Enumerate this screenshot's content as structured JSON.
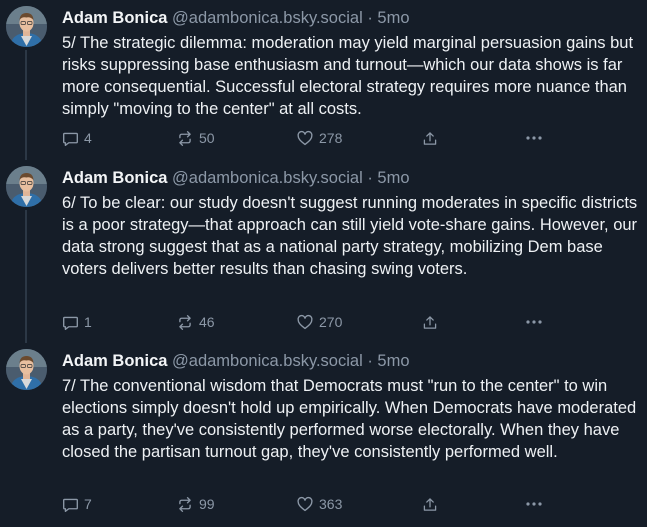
{
  "posts": [
    {
      "author": "Adam Bonica",
      "handle": "@adambonica.bsky.social",
      "separator": "·",
      "time": "5mo",
      "text": "5/ The strategic dilemma: moderation may yield marginal persuasion gains but risks suppressing base enthusiasm and turnout—which our data shows is far more consequential. Successful electoral strategy requires more nuance than simply \"moving to the center\" at all costs.",
      "replies": "4",
      "reposts": "50",
      "likes": "278"
    },
    {
      "author": "Adam Bonica",
      "handle": "@adambonica.bsky.social",
      "separator": "·",
      "time": "5mo",
      "text": "6/ To be clear: our study doesn't suggest running moderates in specific districts is a poor strategy—that approach can still yield vote-share gains. However, our data strong suggest that as a national party strategy, mobilizing Dem base voters delivers better results than chasing swing voters.",
      "replies": "1",
      "reposts": "46",
      "likes": "270"
    },
    {
      "author": "Adam Bonica",
      "handle": "@adambonica.bsky.social",
      "separator": "·",
      "time": "5mo",
      "text": "7/ The conventional wisdom that Democrats must \"run to the center\" to win elections simply doesn't hold up empirically. When Democrats have moderated as a party, they've consistently performed worse electorally. When they have closed the partisan turnout gap, they've consistently performed well.",
      "replies": "7",
      "reposts": "99",
      "likes": "363"
    }
  ],
  "colors": {
    "background": "#151d28",
    "text": "#eef1f4",
    "muted": "#8c98a7",
    "thread_line": "#2c3846"
  },
  "icons": {
    "reply": "speech-bubble-icon",
    "repost": "repost-arrows-icon",
    "like": "heart-icon",
    "share": "share-arrow-icon",
    "more": "ellipsis-icon"
  }
}
